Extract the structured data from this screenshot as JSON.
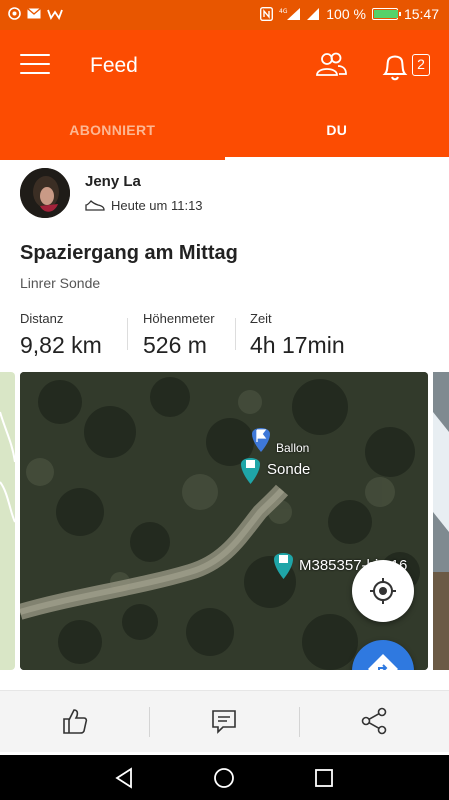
{
  "status_bar": {
    "battery": "100 %",
    "time": "15:47",
    "battery_level": 1.0
  },
  "app_bar": {
    "title": "Feed",
    "notification_count": "2"
  },
  "tabs": [
    {
      "label": "ABONNIERT",
      "active": false
    },
    {
      "label": "DU",
      "active": true
    }
  ],
  "activity": {
    "athlete_name": "Jeny La",
    "timestamp": "Heute um 11:13",
    "title": "Spaziergang am Mittag",
    "location": "Linrer Sonde",
    "stats": [
      {
        "label": "Distanz",
        "value": "9,82 km"
      },
      {
        "label": "Höhenmeter",
        "value": "526 m"
      },
      {
        "label": "Zeit",
        "value": "4h 17min"
      }
    ],
    "map": {
      "markers": [
        {
          "label": "Ballon"
        },
        {
          "label": "Sonde"
        },
        {
          "label": "M385357-biz-16"
        }
      ]
    }
  },
  "colors": {
    "brand": "#fc4c02",
    "status_bar": "#e85600",
    "map_button": "#2f79e0"
  },
  "icons": [
    "menu-icon",
    "friends-icon",
    "bell-icon",
    "shoe-icon",
    "locate-icon",
    "directions-icon",
    "like-icon",
    "comment-icon",
    "share-icon",
    "back-icon",
    "home-icon",
    "recents-icon"
  ]
}
